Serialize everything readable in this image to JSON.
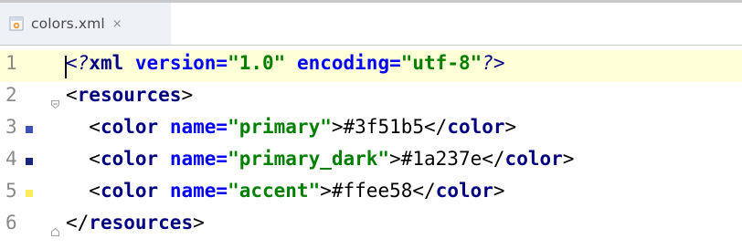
{
  "tab": {
    "filename": "colors.xml",
    "close_glyph": "×",
    "icon": "xml-file-icon"
  },
  "editor": {
    "current_line": 1,
    "lines": [
      {
        "number": "1",
        "parts": {
          "open_meta": "<?",
          "decl": "xml",
          "sp1": " ",
          "attr1": "version",
          "eq1": "=",
          "val1": "\"1.0\"",
          "sp2": " ",
          "attr2": "encoding",
          "eq2": "=",
          "val2": "\"utf-8\"",
          "close_meta": "?>"
        }
      },
      {
        "number": "2",
        "fold": "collapse",
        "parts": {
          "open": "<",
          "tag": "resources",
          "close": ">"
        }
      },
      {
        "number": "3",
        "swatch": "#3f51b5",
        "parts": {
          "indent": "  ",
          "open": "<",
          "tag": "color",
          "sp": " ",
          "attr": "name",
          "eq": "=",
          "val": "\"primary\"",
          "gt": ">",
          "text": "#3f51b5",
          "endopen": "</",
          "endtag": "color",
          "endclose": ">"
        }
      },
      {
        "number": "4",
        "swatch": "#1a237e",
        "parts": {
          "indent": "  ",
          "open": "<",
          "tag": "color",
          "sp": " ",
          "attr": "name",
          "eq": "=",
          "val": "\"primary_dark\"",
          "gt": ">",
          "text": "#1a237e",
          "endopen": "</",
          "endtag": "color",
          "endclose": ">"
        }
      },
      {
        "number": "5",
        "swatch": "#ffee58",
        "parts": {
          "indent": "  ",
          "open": "<",
          "tag": "color",
          "sp": " ",
          "attr": "name",
          "eq": "=",
          "val": "\"accent\"",
          "gt": ">",
          "text": "#ffee58",
          "endopen": "</",
          "endtag": "color",
          "endclose": ">"
        }
      },
      {
        "number": "6",
        "fold": "end",
        "parts": {
          "open": "</",
          "tag": "resources",
          "close": ">"
        }
      }
    ]
  },
  "colors": {
    "current_line_bg": "#ffffd7",
    "tab_bg": "#eef1f6",
    "tag": "#000080",
    "attribute": "#0000ff",
    "string": "#008000",
    "line_number": "#8a8a8a"
  }
}
